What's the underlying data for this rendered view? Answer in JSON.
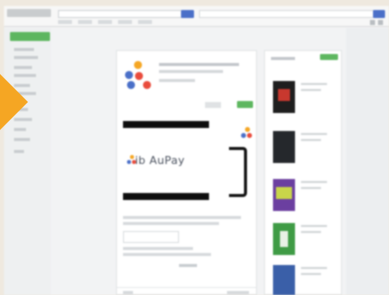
{
  "header": {
    "search_placeholder": "",
    "tabs": [
      "",
      "",
      "",
      "",
      ""
    ]
  },
  "sidebar": {
    "apps_label": ""
  },
  "app": {
    "title": "",
    "screenshot_text": "ib AuPay"
  },
  "colors": {
    "accent_green": "#5db65f",
    "search_blue": "#4a6fc8",
    "arrow_orange": "#f5a623",
    "redaction": "#0d0d0d"
  },
  "icons": [
    "search-icon",
    "app-logo-icon",
    "arrow-pointer-icon"
  ]
}
